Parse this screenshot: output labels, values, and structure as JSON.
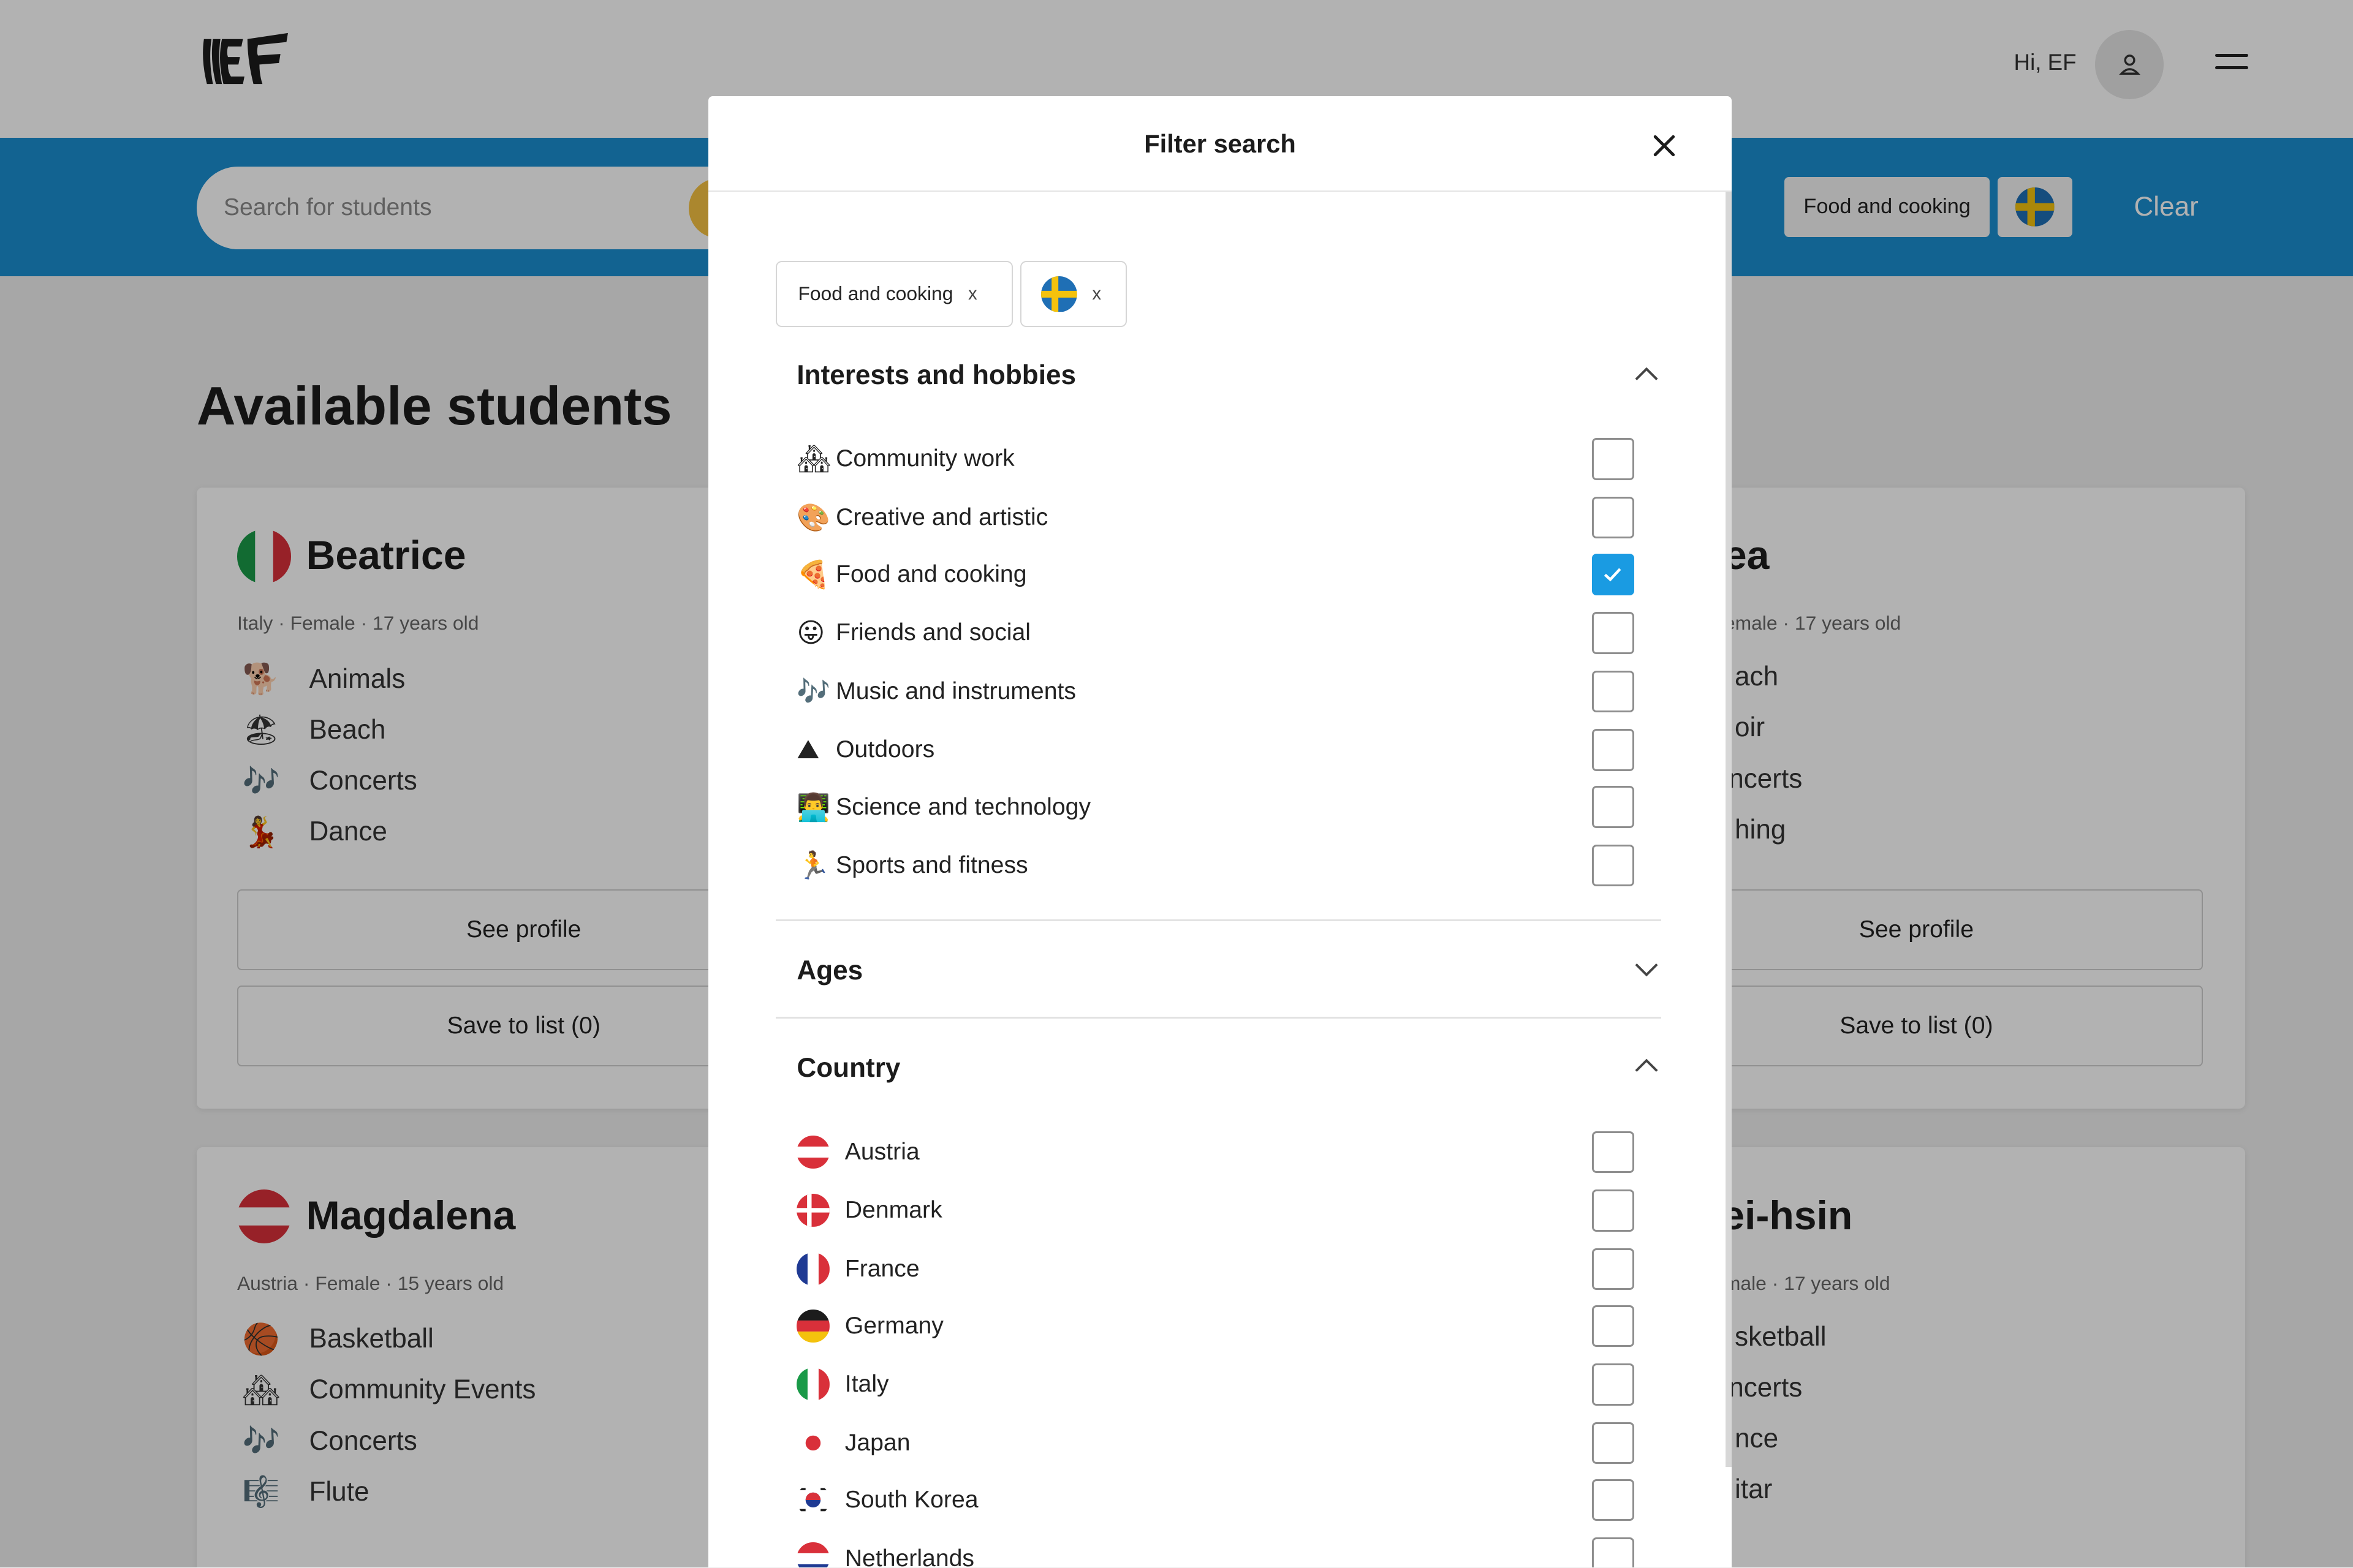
{
  "header": {
    "greeting": "Hi, EF"
  },
  "search": {
    "placeholder": "Search for students"
  },
  "active_filters_bar": {
    "interest_chip": "Food and cooking",
    "clear_label": "Clear"
  },
  "page": {
    "heading": "Available students"
  },
  "cards": [
    {
      "name": "Beatrice",
      "meta": "Italy · Female · 17 years old",
      "interests": [
        {
          "emoji": "🐕",
          "label": "Animals"
        },
        {
          "emoji": "🏖",
          "label": "Beach"
        },
        {
          "emoji": "🎶",
          "label": "Concerts"
        },
        {
          "emoji": "💃",
          "label": "Dance"
        }
      ],
      "see_profile": "See profile",
      "save_to_list": "Save to list (0)"
    },
    {
      "name": "ea",
      "meta": "emale · 17 years old",
      "interests": [
        {
          "label": "ach"
        },
        {
          "label": "oir"
        },
        {
          "label": "ncerts"
        },
        {
          "label": "hing"
        }
      ],
      "see_profile": "See profile",
      "save_to_list": "Save to list (0)"
    },
    {
      "name": "Magdalena",
      "meta": "Austria · Female · 15 years old",
      "interests": [
        {
          "emoji": "🏀",
          "label": "Basketball"
        },
        {
          "emoji": "🏘",
          "label": "Community Events"
        },
        {
          "emoji": "🎶",
          "label": "Concerts"
        },
        {
          "emoji": "🎼",
          "label": "Flute"
        }
      ]
    },
    {
      "name": "/ei-hsin",
      "meta": "male · 17 years old",
      "interests": [
        {
          "label": "sketball"
        },
        {
          "label": "ncerts"
        },
        {
          "label": "nce"
        },
        {
          "label": "itar"
        }
      ]
    }
  ],
  "modal": {
    "title": "Filter search",
    "selected_pills": [
      {
        "label": "Food and cooking",
        "remove": "x"
      },
      {
        "label": "",
        "remove": "x"
      }
    ],
    "interests_section": {
      "title": "Interests and hobbies",
      "options": [
        {
          "emoji": "🏘",
          "label": "Community work",
          "checked": false
        },
        {
          "emoji": "🎨",
          "label": "Creative and artistic",
          "checked": false
        },
        {
          "emoji": "🍕",
          "label": "Food and cooking",
          "checked": true
        },
        {
          "emoji": "😛",
          "label": "Friends and social",
          "checked": false
        },
        {
          "emoji": "🎶",
          "label": "Music and instruments",
          "checked": false
        },
        {
          "emoji": "⛰",
          "label": "Outdoors",
          "checked": false
        },
        {
          "emoji": "👨‍💻",
          "label": "Science and technology",
          "checked": false
        },
        {
          "emoji": "🏃",
          "label": "Sports and fitness",
          "checked": false
        }
      ]
    },
    "ages_section": {
      "title": "Ages"
    },
    "country_section": {
      "title": "Country",
      "options": [
        {
          "label": "Austria",
          "checked": false
        },
        {
          "label": "Denmark",
          "checked": false
        },
        {
          "label": "France",
          "checked": false
        },
        {
          "label": "Germany",
          "checked": false
        },
        {
          "label": "Italy",
          "checked": false
        },
        {
          "label": "Japan",
          "checked": false
        },
        {
          "label": "South Korea",
          "checked": false
        },
        {
          "label": "Netherlands",
          "checked": false
        }
      ]
    }
  },
  "colors": {
    "brand_blue": "#1a8ed0",
    "check_blue": "#1a9be2",
    "search_yellow": "#f5c242"
  }
}
